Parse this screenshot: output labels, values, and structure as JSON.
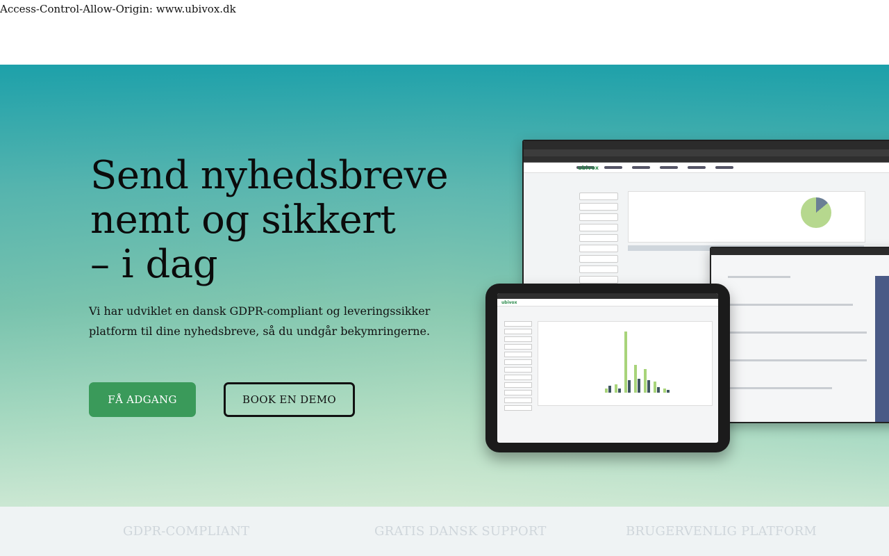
{
  "top_header_text": "Access-Control-Allow-Origin: www.ubivox.dk",
  "hero": {
    "headline_lines": [
      "Send nyhedsbreve",
      "nemt og sikkert",
      "– i dag"
    ],
    "subtext_line1": "Vi har udviklet en dansk GDPR-compliant og leveringssikker",
    "subtext_line2": "platform til dine nyhedsbreve, så du undgår bekymringerne.",
    "primary_button": "FÅ ADGANG",
    "secondary_button": "BOOK EN DEMO",
    "mockup_logo": "ubivox"
  },
  "features": [
    "GDPR-COMPLIANT",
    "GRATIS DANSK SUPPORT",
    "BRUGERVENLIG PLATFORM"
  ],
  "colors": {
    "primary_button": "#3a9a5a",
    "hero_top": "#1aa2a7",
    "hero_bottom": "#dceed7",
    "features_bg": "#eff3f4",
    "features_text": "#cfd6db"
  }
}
